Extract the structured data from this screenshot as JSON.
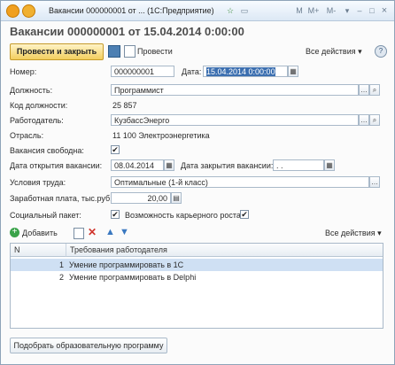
{
  "titlebar": {
    "title": "Вакансии 000000001 от ... (1С:Предприятие)",
    "buttons": [
      "☆",
      "▭",
      "M",
      "M+",
      "M-",
      "▾",
      "–",
      "□",
      "×"
    ]
  },
  "header": {
    "title": "Вакансии 000000001 от 15.04.2014 0:00:00"
  },
  "toolbar": {
    "post_close_label": "Провести и закрыть",
    "post_label": "Провести",
    "all_actions_label": "Все действия ▾",
    "help_label": "?"
  },
  "form": {
    "number_label": "Номер:",
    "number_value": "000000001",
    "date_label": "Дата:",
    "date_value": "15.04.2014  0:00:00",
    "position_label": "Должность:",
    "position_value": "Программист",
    "position_code_label": "Код должности:",
    "position_code_value": "25 857",
    "employer_label": "Работодатель:",
    "employer_value": "КузбассЭнерго",
    "industry_label": "Отрасль:",
    "industry_value": "11 100 Электроэнергетика",
    "vacancy_free_label": "Вакансия свободна:",
    "open_date_label": "Дата открытия вакансии:",
    "open_date_value": "08.04.2014",
    "close_date_label": "Дата закрытия вакансии:",
    "close_date_value": " .  .",
    "conditions_label": "Условия труда:",
    "conditions_value": "Оптимальные (1-й класс)",
    "salary_label": "Заработная плата, тыс.руб.:",
    "salary_value": "20,00",
    "social_label": "Социальный пакет:",
    "career_label": "Возможность карьерного роста:",
    "checked_mark": "✔"
  },
  "requirements": {
    "add_label": "Добавить",
    "all_actions_label": "Все действия ▾",
    "columns": [
      "N",
      "Требования работодателя"
    ],
    "rows": [
      {
        "n": "1",
        "text": "Умение программировать в 1С"
      },
      {
        "n": "2",
        "text": "Умение программировать в Delphi"
      }
    ]
  },
  "footer": {
    "select_program_label": "Подобрать образовательную программу"
  }
}
